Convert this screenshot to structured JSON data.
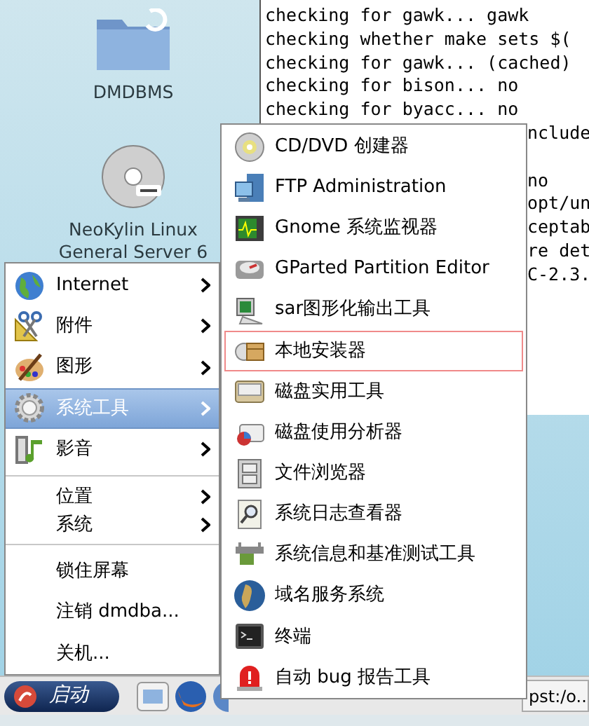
{
  "desktop_icons": [
    {
      "label": "DMDBMS"
    },
    {
      "label": "NeoKylin Linux General Server 6"
    }
  ],
  "terminal": {
    "lines": [
      {
        "kind": "full",
        "text": "checking for gawk... gawk"
      },
      {
        "kind": "full",
        "text": "checking whether make sets $("
      },
      {
        "kind": "full",
        "text": "checking for gawk... (cached)"
      },
      {
        "kind": "full",
        "text": "checking for bison... no"
      },
      {
        "kind": "full",
        "text": "checking for byacc... no"
      },
      {
        "kind": "tail",
        "text": "nclude"
      },
      {
        "kind": "blank"
      },
      {
        "kind": "tail",
        "text": "no"
      },
      {
        "kind": "tail",
        "text": "opt/un"
      },
      {
        "kind": "tail",
        "text": "ceptab"
      },
      {
        "kind": "tail",
        "text": "re det"
      },
      {
        "kind": "tail",
        "text": "C-2.3."
      }
    ]
  },
  "main_menu": {
    "items": [
      {
        "kind": "icon",
        "label": "Internet",
        "submenu": true,
        "selected": false
      },
      {
        "kind": "icon",
        "label": "附件",
        "submenu": true,
        "selected": false
      },
      {
        "kind": "icon",
        "label": "图形",
        "submenu": true,
        "selected": false
      },
      {
        "kind": "icon",
        "label": "系统工具",
        "submenu": true,
        "selected": true
      },
      {
        "kind": "icon",
        "label": "影音",
        "submenu": true,
        "selected": false
      },
      {
        "kind": "separator"
      },
      {
        "kind": "compact",
        "label": "位置",
        "submenu": true,
        "selected": false
      },
      {
        "kind": "compact",
        "label": "系统",
        "submenu": true,
        "selected": false
      },
      {
        "kind": "separator"
      },
      {
        "kind": "plain",
        "label": "锁住屏幕",
        "submenu": false,
        "selected": false
      },
      {
        "kind": "plain",
        "label": "注销 dmdba...",
        "submenu": false,
        "selected": false
      },
      {
        "kind": "plain",
        "label": "关机...",
        "submenu": false,
        "selected": false
      }
    ]
  },
  "submenu": {
    "items": [
      {
        "label": "CD/DVD 创建器",
        "selected": false
      },
      {
        "label": "FTP Administration",
        "selected": false
      },
      {
        "label": "Gnome 系统监视器",
        "selected": false
      },
      {
        "label": "GParted Partition Editor",
        "selected": false
      },
      {
        "label": "sar图形化输出工具",
        "selected": false
      },
      {
        "label": "本地安装器",
        "selected": true
      },
      {
        "label": "磁盘实用工具",
        "selected": false
      },
      {
        "label": "磁盘使用分析器",
        "selected": false
      },
      {
        "label": "文件浏览器",
        "selected": false
      },
      {
        "label": "系统日志查看器",
        "selected": false
      },
      {
        "label": "系统信息和基准测试工具",
        "selected": false
      },
      {
        "label": "域名服务系统",
        "selected": false
      },
      {
        "label": "终端",
        "selected": false
      },
      {
        "label": "自动 bug 报告工具",
        "selected": false
      }
    ]
  },
  "taskbar": {
    "start_label": "启动",
    "window_button": "pst:/o..."
  }
}
